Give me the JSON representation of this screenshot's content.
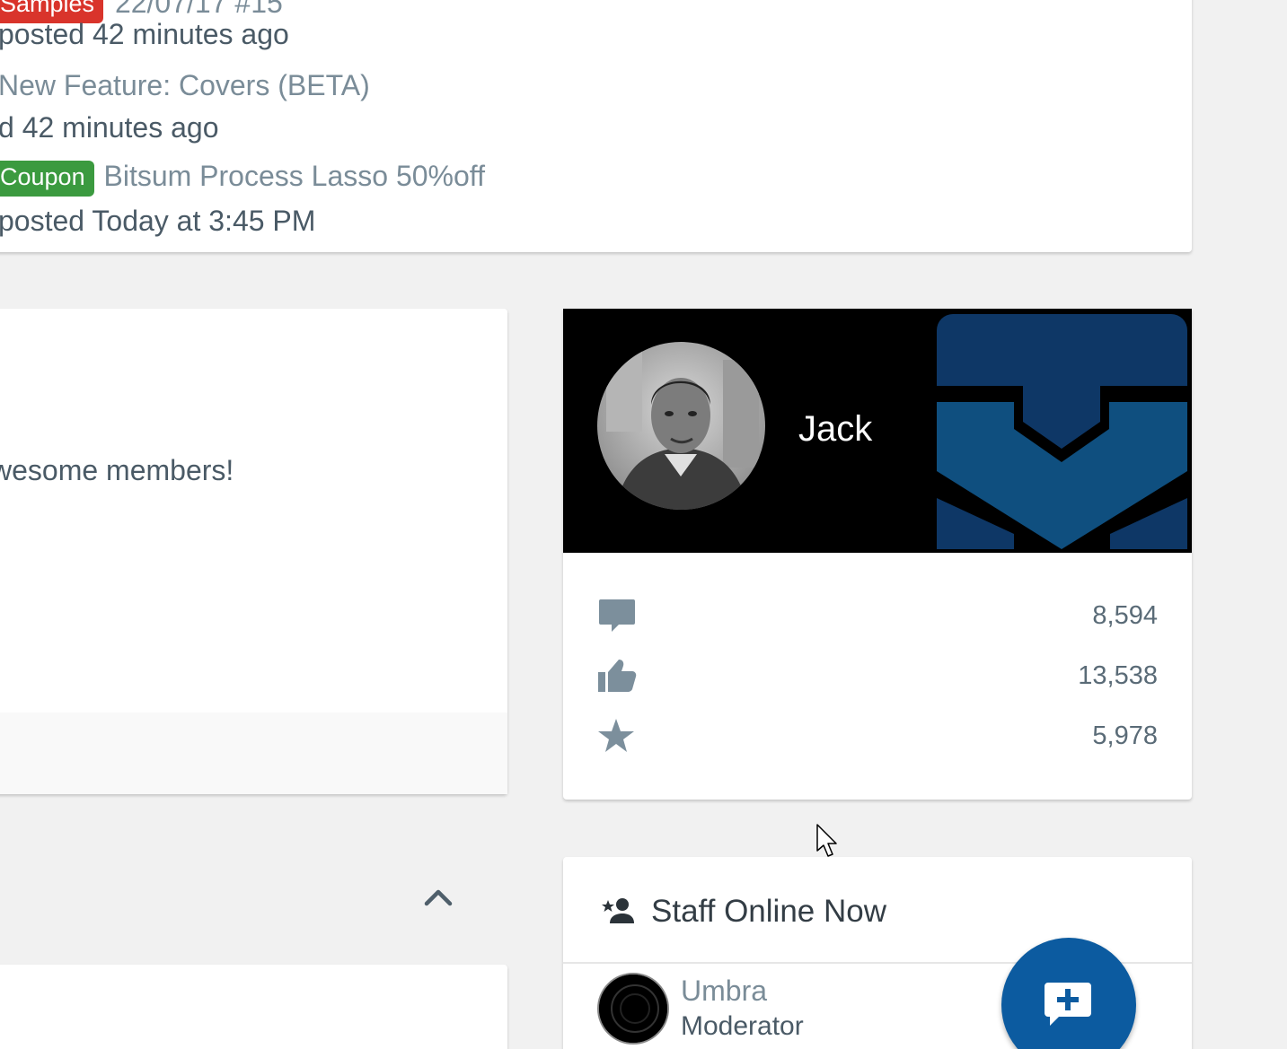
{
  "latest_posts": [
    {
      "prefix": "Samples",
      "title": "22/07/17 #15",
      "meta": "posted 42 minutes ago"
    },
    {
      "title": "New Feature: Covers (BETA)",
      "meta": "d 42 minutes ago"
    },
    {
      "prefix": "Coupon",
      "title": "Bitsum Process Lasso 50%off",
      "meta": "posted Today at 3:45 PM"
    }
  ],
  "welcome": {
    "text": "wesome members!"
  },
  "profile": {
    "name": "Jack",
    "stats": [
      {
        "icon": "message-icon",
        "value": "8,594"
      },
      {
        "icon": "thumbs-up-icon",
        "value": "13,538"
      },
      {
        "icon": "star-icon",
        "value": "5,978"
      }
    ]
  },
  "staff": {
    "title": "Staff Online Now",
    "members": [
      {
        "name": "Umbra",
        "role": "Moderator"
      }
    ]
  },
  "colors": {
    "label_samples": "#d9342b",
    "label_coupon": "#3b9a3f",
    "fab": "#0c5ba0",
    "banner_logo": "#0e4f82"
  }
}
